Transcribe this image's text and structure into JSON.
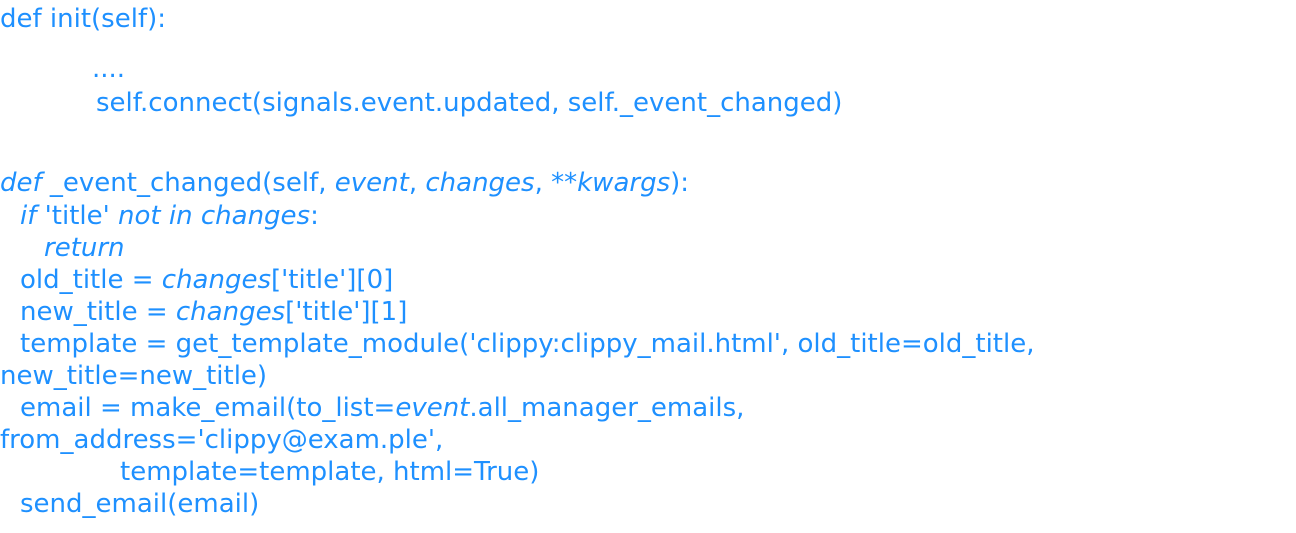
{
  "code": {
    "line1": "def init(self):",
    "line2": "....",
    "line3": "self.connect(signals.event.updated, self._event_changed)",
    "line4": {
      "kw_def": "def",
      "name": " _event_changed(self, ",
      "p_event": "event",
      "sep1": ", ",
      "p_changes": "changes",
      "sep2": ", ",
      "p_kwargs": "**kwargs",
      "end": "):"
    },
    "line5": {
      "kw_if": "if",
      "str_title": " 'title' ",
      "kw_not_in": "not in changes",
      "colon": ":"
    },
    "line6": {
      "kw_return": "return"
    },
    "line7": {
      "lhs": "old_title = ",
      "var": "changes",
      "rest": "['title'][0]"
    },
    "line8": {
      "lhs": "new_title = ",
      "var": "changes",
      "rest": "['title'][1]"
    },
    "line9": "template = get_template_module('clippy:clippy_mail.html', old_title=old_title,",
    "line10": "new_title=new_title)",
    "line11": {
      "pre": "email = make_email(to_list=",
      "var": "event",
      "post": ".all_manager_emails,"
    },
    "line12": "from_address='clippy@exam.ple',",
    "line13": "template=template, html=True)",
    "line14": "send_email(email)"
  }
}
